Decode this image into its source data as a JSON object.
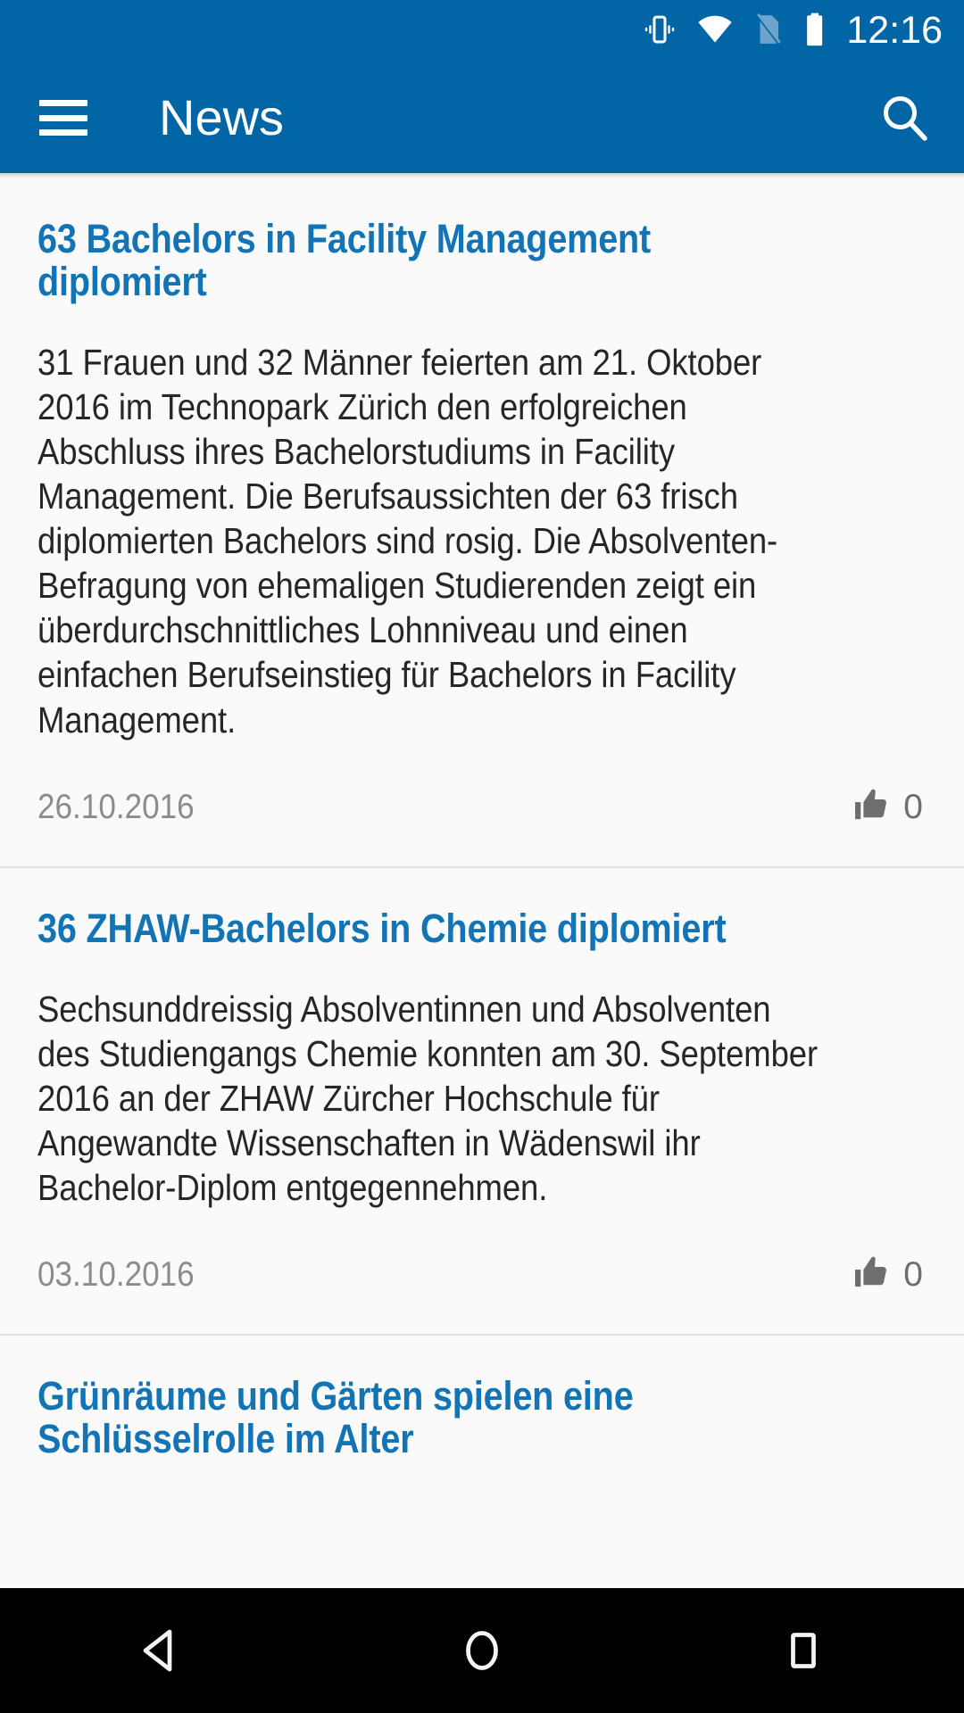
{
  "status_bar": {
    "time": "12:16",
    "icons": [
      "vibrate-icon",
      "wifi-icon",
      "no-sim-icon",
      "battery-full-icon"
    ]
  },
  "toolbar": {
    "title": "News",
    "menu_icon": "hamburger-menu-icon",
    "search_icon": "search-icon",
    "background_color": "#0265a6"
  },
  "theme": {
    "accent": "#0265a6",
    "link_blue": "#1273b5",
    "body_text": "#262626",
    "meta_gray": "#8c8c8c"
  },
  "articles": [
    {
      "title": "63 Bachelors in Facility Management diplomiert",
      "body": "31 Frauen und 32 Männer feierten am 21. Oktober 2016 im Technopark Zürich den erfolgreichen Abschluss ihres Bachelorstudiums in Facility Management. Die Berufsaussichten der 63 frisch diplomierten Bachelors sind rosig. Die Absolventen-Befragung von ehemaligen Studierenden zeigt ein überdurchschnittliches Lohnniveau und einen einfachen Berufseinstieg für Bachelors in Facility Management.",
      "date": "26.10.2016",
      "likes": "0",
      "like_icon": "thumbs-up-icon"
    },
    {
      "title": "36 ZHAW-Bachelors in Chemie diplomiert",
      "body": "Sechsunddreissig Absolventinnen und Absolventen des Studiengangs Chemie konnten am 30. September 2016 an der ZHAW Zürcher Hochschule für Angewandte Wissenschaften in Wädenswil ihr Bachelor-Diplom entgegennehmen.",
      "date": "03.10.2016",
      "likes": "0",
      "like_icon": "thumbs-up-icon"
    },
    {
      "title": "Grünräume und Gärten spielen eine Schlüsselrolle im Alter",
      "body": "",
      "date": "",
      "likes": "",
      "like_icon": "thumbs-up-icon"
    }
  ],
  "nav_bar": {
    "back_icon": "back-triangle-icon",
    "home_icon": "home-circle-icon",
    "recents_icon": "recents-square-icon"
  }
}
